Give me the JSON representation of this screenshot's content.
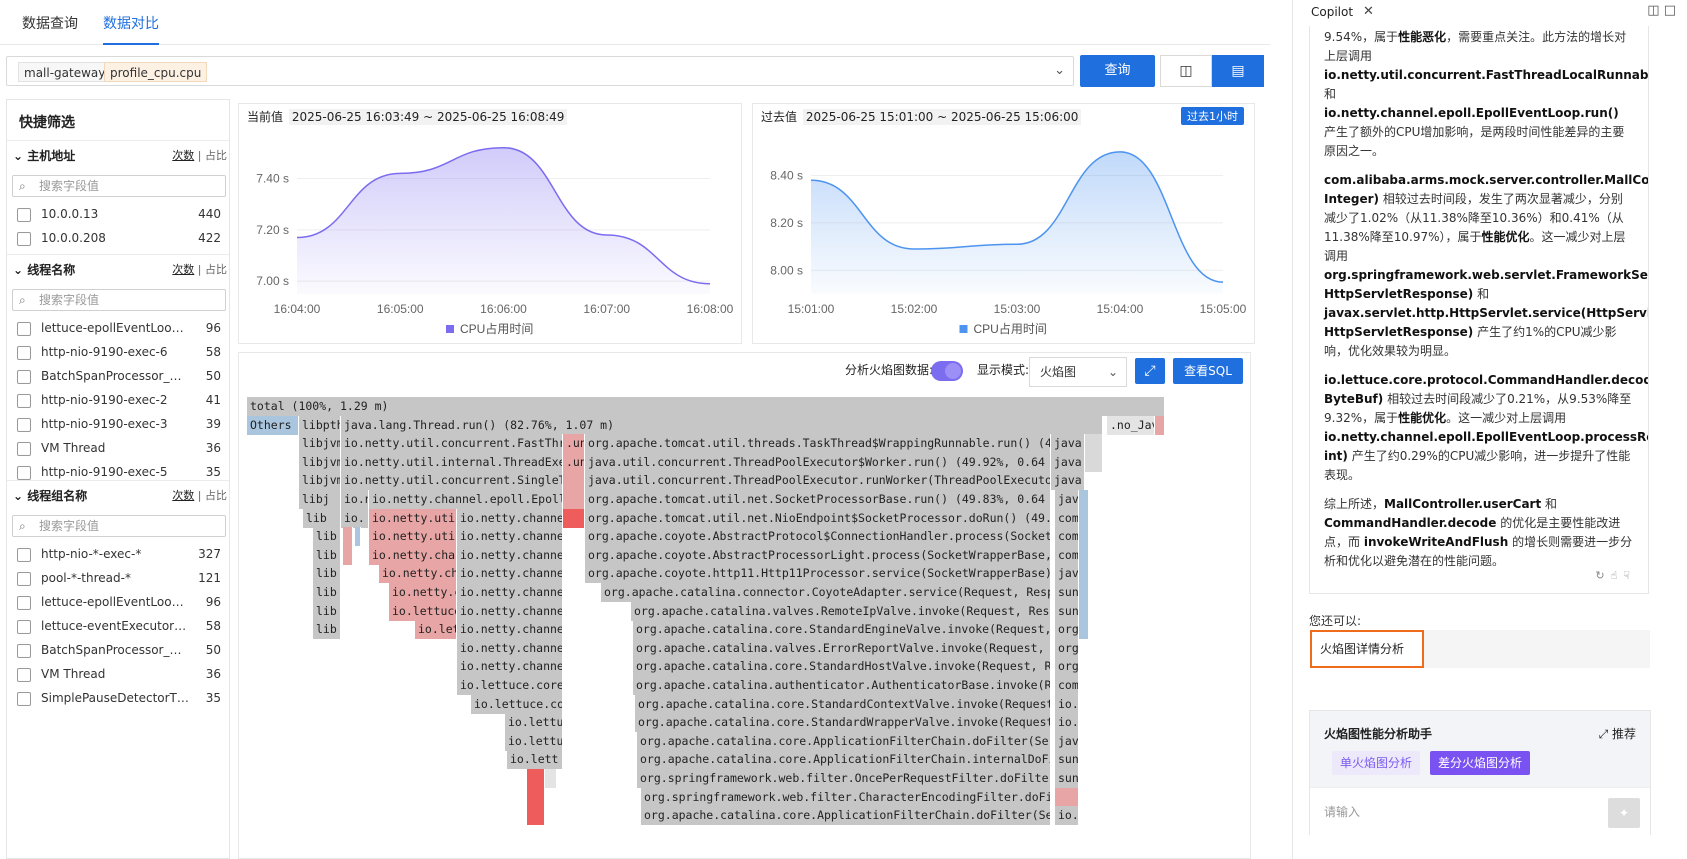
{
  "tabs": [
    "数据查询",
    "数据对比"
  ],
  "query": {
    "tags": [
      "mall-gateway",
      "profile_cpu.cpu"
    ],
    "button": "查询"
  },
  "filter": {
    "title": "快捷筛选",
    "placeholder": "搜索字段值",
    "toggle": [
      "次数",
      "占比"
    ],
    "sections": [
      {
        "title": "主机地址",
        "rows": [
          {
            "name": "10.0.0.13",
            "count": "440"
          },
          {
            "name": "10.0.0.208",
            "count": "422"
          }
        ]
      },
      {
        "title": "线程名称",
        "rows": [
          {
            "name": "lettuce-epollEventLoop-7-1",
            "count": "96"
          },
          {
            "name": "http-nio-9190-exec-6",
            "count": "58"
          },
          {
            "name": "BatchSpanProcessor_Work...",
            "count": "50"
          },
          {
            "name": "http-nio-9190-exec-2",
            "count": "41"
          },
          {
            "name": "http-nio-9190-exec-3",
            "count": "39"
          },
          {
            "name": "VM Thread",
            "count": "36"
          },
          {
            "name": "http-nio-9190-exec-5",
            "count": "35"
          }
        ]
      },
      {
        "title": "线程组名称",
        "rows": [
          {
            "name": "http-nio-*-exec-*",
            "count": "327"
          },
          {
            "name": "pool-*-thread-*",
            "count": "121"
          },
          {
            "name": "lettuce-epollEventLoop-*-*",
            "count": "96"
          },
          {
            "name": "lettuce-eventExecutorLoo...",
            "count": "58"
          },
          {
            "name": "BatchSpanProcessor_Work...",
            "count": "50"
          },
          {
            "name": "VM Thread",
            "count": "36"
          },
          {
            "name": "SimplePauseDetectorThrea...",
            "count": "35"
          }
        ]
      }
    ]
  },
  "chart_data": [
    {
      "type": "area",
      "label": "当前值",
      "range": "2025-06-25 16:03:49 ~ 2025-06-25 16:08:49",
      "x": [
        "16:04:00",
        "16:05:00",
        "16:06:00",
        "16:07:00",
        "16:08:00"
      ],
      "y": [
        7.17,
        7.42,
        7.52,
        7.18,
        6.99
      ],
      "yticks": [
        "7.00 s",
        "7.20 s",
        "7.40 s"
      ],
      "ylim": [
        6.95,
        7.55
      ],
      "legend": "CPU占用时间",
      "color": "#7b6cf0"
    },
    {
      "type": "area",
      "label": "过去值",
      "range": "2025-06-25 15:01:00 ~ 2025-06-25 15:06:00",
      "badge": "过去1小时",
      "x": [
        "15:01:00",
        "15:02:00",
        "15:03:00",
        "15:04:00",
        "15:05:00"
      ],
      "y": [
        8.38,
        8.09,
        8.11,
        8.5,
        7.95
      ],
      "yticks": [
        "8.00 s",
        "8.20 s",
        "8.40 s"
      ],
      "ylim": [
        7.9,
        8.55
      ],
      "legend": "CPU占用时间",
      "color": "#4d94f0"
    }
  ],
  "flame": {
    "label": "分析火焰图数据:",
    "mode_label": "显示模式:",
    "mode": "火焰图",
    "sql": "查看SQL",
    "frames": [
      {
        "t": "total (100%, 1.29 m)",
        "x": 0,
        "y": 0,
        "w": 918,
        "c": "g"
      },
      {
        "t": "Others (",
        "x": 0,
        "y": 1,
        "w": 52,
        "c": "b"
      },
      {
        "t": "libpthr",
        "x": 52,
        "y": 1,
        "w": 42,
        "c": "g"
      },
      {
        "t": "java.lang.Thread.run() (82.76%, 1.07 m)",
        "x": 94,
        "y": 1,
        "w": 762,
        "c": "g"
      },
      {
        "t": ".no_Java",
        "x": 860,
        "y": 1,
        "w": 48,
        "c": "lg"
      },
      {
        "t": "",
        "x": 908,
        "y": 1,
        "w": 10,
        "c": "r"
      },
      {
        "t": "libjvm",
        "x": 52,
        "y": 2,
        "w": 42,
        "c": "g"
      },
      {
        "t": "io.netty.util.concurrent.FastThrea",
        "x": 94,
        "y": 2,
        "w": 222,
        "c": "g"
      },
      {
        "t": ".un",
        "x": 316,
        "y": 2,
        "w": 22,
        "c": "r"
      },
      {
        "t": "org.apache.tomcat.util.threads.TaskThread$WrappingRunnable.run() (49.92",
        "x": 338,
        "y": 2,
        "w": 466,
        "c": "g"
      },
      {
        "t": "java.",
        "x": 804,
        "y": 2,
        "w": 34,
        "c": "g"
      },
      {
        "t": "",
        "x": 838,
        "y": 2,
        "w": 18,
        "c": "gl"
      },
      {
        "t": "libjvm",
        "x": 52,
        "y": 3,
        "w": 42,
        "c": "g"
      },
      {
        "t": "io.netty.util.internal.ThreadExecu",
        "x": 94,
        "y": 3,
        "w": 222,
        "c": "g"
      },
      {
        "t": ".un",
        "x": 316,
        "y": 3,
        "w": 22,
        "c": "r"
      },
      {
        "t": "java.util.concurrent.ThreadPoolExecutor$Worker.run() (49.92%, 0.64 m)",
        "x": 338,
        "y": 3,
        "w": 466,
        "c": "g"
      },
      {
        "t": "java.",
        "x": 804,
        "y": 3,
        "w": 34,
        "c": "g"
      },
      {
        "t": "",
        "x": 838,
        "y": 3,
        "w": 18,
        "c": "gl"
      },
      {
        "t": "libjvm",
        "x": 52,
        "y": 4,
        "w": 42,
        "c": "g"
      },
      {
        "t": "io.netty.util.concurrent.SingleThr",
        "x": 94,
        "y": 4,
        "w": 222,
        "c": "g"
      },
      {
        "t": "",
        "x": 316,
        "y": 4,
        "w": 22,
        "c": "r"
      },
      {
        "t": "java.util.concurrent.ThreadPoolExecutor.runWorker(ThreadPoolExecutor$Wo",
        "x": 338,
        "y": 4,
        "w": 466,
        "c": "g"
      },
      {
        "t": "java.",
        "x": 804,
        "y": 4,
        "w": 34,
        "c": "g"
      },
      {
        "t": "libj",
        "x": 52,
        "y": 5,
        "w": 42,
        "c": "g"
      },
      {
        "t": "io.n",
        "x": 94,
        "y": 5,
        "w": 28,
        "c": "g"
      },
      {
        "t": "io.netty.channel.epoll.EpollEv",
        "x": 122,
        "y": 5,
        "w": 194,
        "c": "g"
      },
      {
        "t": "",
        "x": 316,
        "y": 5,
        "w": 22,
        "c": "r"
      },
      {
        "t": "org.apache.tomcat.util.net.SocketProcessorBase.run() (49.83%, 0.64 m)",
        "x": 338,
        "y": 5,
        "w": 466,
        "c": "g"
      },
      {
        "t": "jav",
        "x": 808,
        "y": 5,
        "w": 24,
        "c": "g"
      },
      {
        "t": "",
        "x": 832,
        "y": 5,
        "w": 10,
        "c": "b"
      },
      {
        "t": "lib",
        "x": 56,
        "y": 6,
        "w": 38,
        "c": "g"
      },
      {
        "t": "io.",
        "x": 94,
        "y": 6,
        "w": 28,
        "c": "g"
      },
      {
        "t": "io.netty.util",
        "x": 122,
        "y": 6,
        "w": 88,
        "c": "r"
      },
      {
        "t": "io.netty.channe",
        "x": 210,
        "y": 6,
        "w": 106,
        "c": "g"
      },
      {
        "t": "",
        "x": 316,
        "y": 6,
        "w": 22,
        "c": "rr"
      },
      {
        "t": "org.apache.tomcat.util.net.NioEndpoint$SocketProcessor.doRun() (49.83%,",
        "x": 338,
        "y": 6,
        "w": 466,
        "c": "g"
      },
      {
        "t": "com",
        "x": 808,
        "y": 6,
        "w": 24,
        "c": "g"
      },
      {
        "t": "",
        "x": 832,
        "y": 6,
        "w": 10,
        "c": "b"
      },
      {
        "t": "lib",
        "x": 66,
        "y": 7,
        "w": 28,
        "c": "g"
      },
      {
        "t": "",
        "x": 96,
        "y": 7,
        "w": 10,
        "c": "r"
      },
      {
        "t": "",
        "x": 108,
        "y": 7,
        "w": 6,
        "c": "b"
      },
      {
        "t": "io.netty.util",
        "x": 122,
        "y": 7,
        "w": 88,
        "c": "r"
      },
      {
        "t": "io.netty.channe",
        "x": 210,
        "y": 7,
        "w": 106,
        "c": "g"
      },
      {
        "t": "org.apache.coyote.AbstractProtocol$ConnectionHandler.process(SocketWrap",
        "x": 338,
        "y": 7,
        "w": 466,
        "c": "g"
      },
      {
        "t": "com",
        "x": 808,
        "y": 7,
        "w": 24,
        "c": "g"
      },
      {
        "t": "",
        "x": 832,
        "y": 7,
        "w": 10,
        "c": "b"
      },
      {
        "t": "lib",
        "x": 66,
        "y": 8,
        "w": 28,
        "c": "g"
      },
      {
        "t": "",
        "x": 96,
        "y": 8,
        "w": 10,
        "c": "r"
      },
      {
        "t": "io.netty.chann",
        "x": 122,
        "y": 8,
        "w": 88,
        "c": "r"
      },
      {
        "t": "io.netty.channe",
        "x": 210,
        "y": 8,
        "w": 106,
        "c": "g"
      },
      {
        "t": "org.apache.coyote.AbstractProcessorLight.process(SocketWrapperBase, Soc",
        "x": 338,
        "y": 8,
        "w": 466,
        "c": "g"
      },
      {
        "t": "com",
        "x": 808,
        "y": 8,
        "w": 24,
        "c": "g"
      },
      {
        "t": "",
        "x": 832,
        "y": 8,
        "w": 10,
        "c": "b"
      },
      {
        "t": "lib",
        "x": 66,
        "y": 9,
        "w": 28,
        "c": "g"
      },
      {
        "t": "io.netty.cha",
        "x": 132,
        "y": 9,
        "w": 78,
        "c": "r"
      },
      {
        "t": "io.netty.channe",
        "x": 210,
        "y": 9,
        "w": 106,
        "c": "g"
      },
      {
        "t": "org.apache.coyote.http11.Http11Processor.service(SocketWrapperBase) (49",
        "x": 338,
        "y": 9,
        "w": 466,
        "c": "g"
      },
      {
        "t": "jav",
        "x": 808,
        "y": 9,
        "w": 24,
        "c": "g"
      },
      {
        "t": "",
        "x": 832,
        "y": 9,
        "w": 10,
        "c": "b"
      },
      {
        "t": "lib",
        "x": 66,
        "y": 10,
        "w": 28,
        "c": "g"
      },
      {
        "t": "io.netty.c",
        "x": 142,
        "y": 10,
        "w": 68,
        "c": "r"
      },
      {
        "t": "io.netty.channe",
        "x": 210,
        "y": 10,
        "w": 106,
        "c": "g"
      },
      {
        "t": "org.apache.catalina.connector.CoyoteAdapter.service(Request, Response",
        "x": 354,
        "y": 10,
        "w": 450,
        "c": "g"
      },
      {
        "t": "sun",
        "x": 808,
        "y": 10,
        "w": 24,
        "c": "g"
      },
      {
        "t": "",
        "x": 832,
        "y": 10,
        "w": 10,
        "c": "b"
      },
      {
        "t": "lib",
        "x": 66,
        "y": 11,
        "w": 28,
        "c": "g"
      },
      {
        "t": "io.lettuce",
        "x": 142,
        "y": 11,
        "w": 68,
        "c": "r"
      },
      {
        "t": "io.netty.channe",
        "x": 210,
        "y": 11,
        "w": 106,
        "c": "g"
      },
      {
        "t": "org.apache.catalina.valves.RemoteIpValve.invoke(Request, Respons",
        "x": 384,
        "y": 11,
        "w": 420,
        "c": "g"
      },
      {
        "t": "sun",
        "x": 808,
        "y": 11,
        "w": 24,
        "c": "g"
      },
      {
        "t": "",
        "x": 832,
        "y": 11,
        "w": 10,
        "c": "b"
      },
      {
        "t": "lib",
        "x": 66,
        "y": 12,
        "w": 28,
        "c": "g"
      },
      {
        "t": "io.let",
        "x": 168,
        "y": 12,
        "w": 42,
        "c": "r"
      },
      {
        "t": "io.netty.channe",
        "x": 210,
        "y": 12,
        "w": 106,
        "c": "g"
      },
      {
        "t": "org.apache.catalina.core.StandardEngineValve.invoke(Request, Res",
        "x": 386,
        "y": 12,
        "w": 418,
        "c": "g"
      },
      {
        "t": "org",
        "x": 808,
        "y": 12,
        "w": 24,
        "c": "g"
      },
      {
        "t": "",
        "x": 832,
        "y": 12,
        "w": 10,
        "c": "b"
      },
      {
        "t": "io.netty.channe",
        "x": 210,
        "y": 13,
        "w": 106,
        "c": "g"
      },
      {
        "t": "org.apache.catalina.valves.ErrorReportValve.invoke(Request, Resp",
        "x": 386,
        "y": 13,
        "w": 418,
        "c": "g"
      },
      {
        "t": "org",
        "x": 808,
        "y": 13,
        "w": 24,
        "c": "g"
      },
      {
        "t": "io.netty.channe",
        "x": 210,
        "y": 14,
        "w": 106,
        "c": "g"
      },
      {
        "t": "org.apache.catalina.core.StandardHostValve.invoke(Request, Respo",
        "x": 386,
        "y": 14,
        "w": 418,
        "c": "g"
      },
      {
        "t": "org",
        "x": 808,
        "y": 14,
        "w": 24,
        "c": "g"
      },
      {
        "t": "io.lettuce.core",
        "x": 210,
        "y": 15,
        "w": 106,
        "c": "g"
      },
      {
        "t": "org.apache.catalina.authenticator.AuthenticatorBase.invoke(Reque",
        "x": 386,
        "y": 15,
        "w": 418,
        "c": "g"
      },
      {
        "t": "com",
        "x": 808,
        "y": 15,
        "w": 24,
        "c": "g"
      },
      {
        "t": "io.lettuce.co",
        "x": 224,
        "y": 16,
        "w": 92,
        "c": "g"
      },
      {
        "t": "org.apache.catalina.core.StandardContextValve.invoke(Request, R",
        "x": 388,
        "y": 16,
        "w": 416,
        "c": "g"
      },
      {
        "t": "io.",
        "x": 808,
        "y": 16,
        "w": 24,
        "c": "g"
      },
      {
        "t": "io.lettu",
        "x": 258,
        "y": 17,
        "w": 58,
        "c": "g"
      },
      {
        "t": "org.apache.catalina.core.StandardWrapperValve.invoke(Request, R",
        "x": 388,
        "y": 17,
        "w": 416,
        "c": "g"
      },
      {
        "t": "io.",
        "x": 808,
        "y": 17,
        "w": 24,
        "c": "g"
      },
      {
        "t": "io.lettu",
        "x": 258,
        "y": 18,
        "w": 58,
        "c": "g"
      },
      {
        "t": "org.apache.catalina.core.ApplicationFilterChain.doFilter(Servle",
        "x": 390,
        "y": 18,
        "w": 414,
        "c": "g"
      },
      {
        "t": "jav",
        "x": 808,
        "y": 18,
        "w": 24,
        "c": "g"
      },
      {
        "t": "io.lett",
        "x": 260,
        "y": 19,
        "w": 56,
        "c": "g"
      },
      {
        "t": "org.apache.catalina.core.ApplicationFilterChain.internalDoFilte",
        "x": 390,
        "y": 19,
        "w": 414,
        "c": "g"
      },
      {
        "t": "sun",
        "x": 808,
        "y": 19,
        "w": 24,
        "c": "g"
      },
      {
        "t": "",
        "x": 280,
        "y": 20,
        "w": 18,
        "c": "rr"
      },
      {
        "t": "",
        "x": 298,
        "y": 20,
        "w": 12,
        "c": "lg"
      },
      {
        "t": "org.springframework.web.filter.OncePerRequestFilter.doFilter(Se",
        "x": 390,
        "y": 20,
        "w": 414,
        "c": "g"
      },
      {
        "t": "sun",
        "x": 808,
        "y": 20,
        "w": 24,
        "c": "g"
      },
      {
        "t": "",
        "x": 280,
        "y": 21,
        "w": 18,
        "c": "rr"
      },
      {
        "t": "org.springframework.web.filter.CharacterEncodingFilter.doFilte",
        "x": 394,
        "y": 21,
        "w": 410,
        "c": "g"
      },
      {
        "t": "",
        "x": 808,
        "y": 21,
        "w": 24,
        "c": "r"
      },
      {
        "t": "",
        "x": 280,
        "y": 22,
        "w": 18,
        "c": "rr"
      },
      {
        "t": "org.apache.catalina.core.ApplicationFilterChain.doFilter(Servl",
        "x": 394,
        "y": 22,
        "w": 410,
        "c": "g"
      },
      {
        "t": "io.",
        "x": 808,
        "y": 22,
        "w": 24,
        "c": "g"
      }
    ]
  },
  "copilot": {
    "tab": "Copilot",
    "msg": [
      [
        "9.54%，属于",
        {
          "b": "性能恶化"
        },
        "，需要重点关注。此方法的增长对上层调用 ",
        {
          "b": "io.netty.util.concurrent.FastThreadLocalRunnable.run()"
        },
        " 和 ",
        {
          "b": "io.netty.channel.epoll.EpollEventLoop.run()"
        },
        " 产生了额外的CPU增加影响，是两段时间性能差异的主要原因之一。"
      ],
      [
        {
          "b": "com.alibaba.arms.mock.server.controller.MallController.userCart(List, Integer)"
        },
        " 相较过去时间段，发生了两次显著减少，分别减少了1.02%（从11.38%降至10.36%）和0.41%（从11.38%降至10.97%），属于",
        {
          "b": "性能优化"
        },
        "。这一减少对上层调用 ",
        {
          "b": "org.springframework.web.servlet.FrameworkServlet.doPost(HttpServletRequest, HttpServletResponse)"
        },
        " 和 ",
        {
          "b": "javax.servlet.http.HttpServlet.service(HttpServletRequest, HttpServletResponse)"
        },
        " 产生了约1%的CPU减少影响，优化效果较为明显。"
      ],
      [
        {
          "b": "io.lettuce.core.protocol.CommandHandler.decode(ChannelHandlerContext, ByteBuf)"
        },
        " 相较过去时间段减少了0.21%，从9.53%降至9.32%，属于",
        {
          "b": "性能优化"
        },
        "。这一减少对上层调用 ",
        {
          "b": "io.netty.channel.epoll.EpollEventLoop.processReady(EpollEventArray, int)"
        },
        " 产生了约0.29%的CPU减少影响，进一步提升了性能表现。"
      ],
      [
        "综上所述，",
        {
          "b": "MallController.userCart"
        },
        " 和 ",
        {
          "b": "CommandHandler.decode"
        },
        " 的优化是主要性能改进点，而 ",
        {
          "b": "invokeWriteAndFlush"
        },
        " 的增长则需要进一步分析和优化以避免潜在的性能问题。"
      ]
    ],
    "also": "您还可以:",
    "suggestion": "火焰图详情分析",
    "assistant": {
      "title": "火焰图性能分析助手",
      "recommend": "推荐",
      "chip1": "单火焰图分析",
      "chip2": "差分火焰图分析",
      "placeholder": "请输入"
    }
  }
}
